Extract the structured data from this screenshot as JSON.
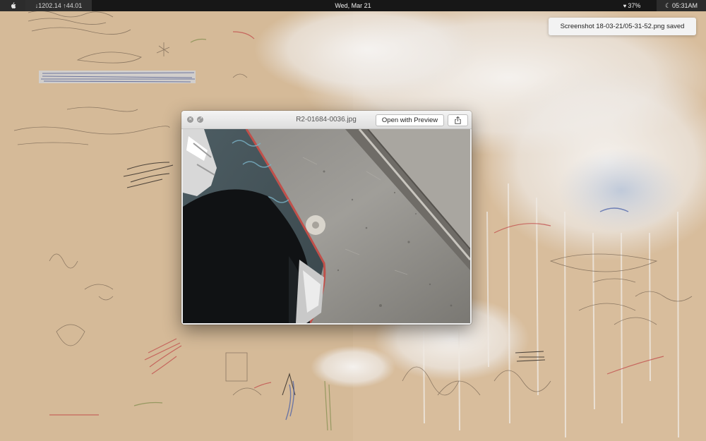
{
  "menubar": {
    "apple_icon": "apple-icon",
    "network_stats": "↓1202.14 ↑44.01",
    "date": "Wed, Mar 21",
    "battery": "37%",
    "battery_icon": "heart-icon",
    "clock": "05:31AM",
    "clock_icon": "moon-icon"
  },
  "notification": {
    "text": "Screenshot 18-03-21/05-31-52.png saved"
  },
  "quicklook": {
    "filename": "R2-01684-0036.jpg",
    "open_button": "Open with Preview",
    "close_icon": "close-icon",
    "fullscreen_icon": "fullscreen-icon",
    "share_icon": "share-icon"
  },
  "colors": {
    "menubar_bg": "#171717",
    "wallpaper_base": "#d9c0a2",
    "window_bg": "#ececec"
  }
}
